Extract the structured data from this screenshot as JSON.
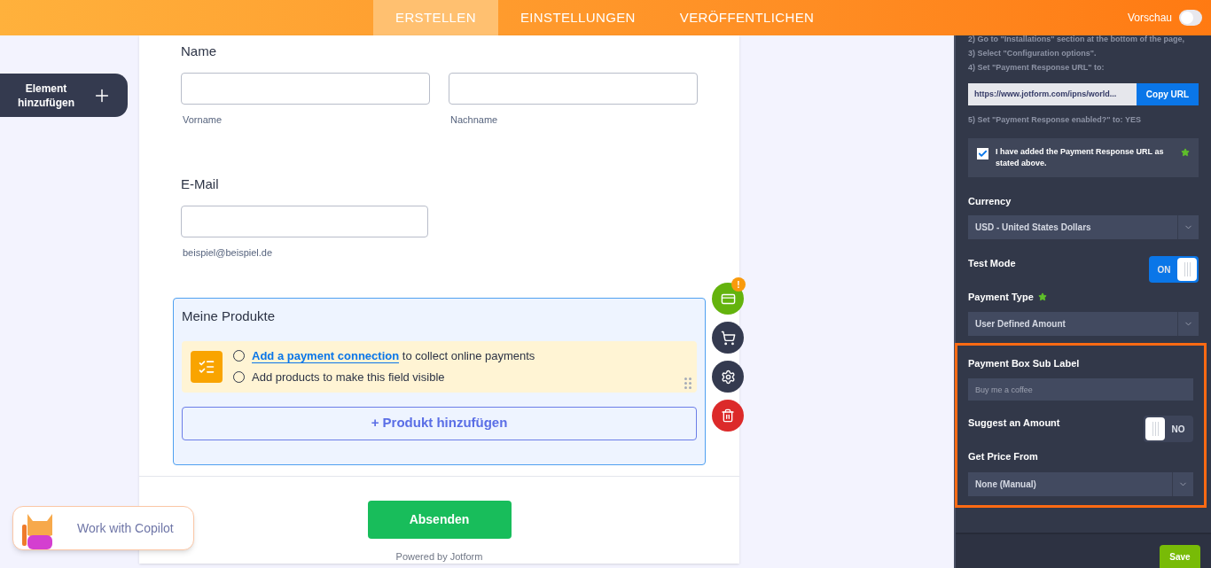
{
  "header": {
    "tabs": [
      {
        "label": "ERSTELLEN",
        "selected": true
      },
      {
        "label": "EINSTELLUNGEN",
        "selected": false
      },
      {
        "label": "VERÖFFENTLICHEN",
        "selected": false
      }
    ],
    "preview": {
      "label": "Vorschau",
      "on": false
    }
  },
  "add_element": {
    "label": "Element hinzufügen"
  },
  "form": {
    "name_field": {
      "label": "Name",
      "inputs": [
        {
          "sublabel": "Vorname"
        },
        {
          "sublabel": "Nachname"
        }
      ]
    },
    "email_field": {
      "label": "E-Mail",
      "sublabel": "beispiel@beispiel.de"
    },
    "products_field": {
      "label": "Meine Produkte",
      "notices": [
        {
          "link": "Add a payment connection",
          "text": "to collect online payments",
          "checked": false
        },
        {
          "text": "Add products to make this field visible",
          "checked": false
        }
      ],
      "add_button": "+ Produkt hinzufügen"
    },
    "submit": "Absenden",
    "powered_by": "Powered by Jotform"
  },
  "field_actions": {
    "badge": "!"
  },
  "copilot": {
    "label": "Work with Copilot"
  },
  "settings_panel": {
    "steps": [
      "2) Go to \"Installations\" section at the bottom of the page,",
      "3) Select \"Configuration options\".",
      "4) Set \"Payment Response URL\" to:"
    ],
    "url": "https://www.jotform.com/ipns/world...",
    "copy_button": "Copy URL",
    "step_5": "5) Set \"Payment Response enabled?\" to: YES",
    "confirm": {
      "label": "I have added the Payment Response URL as stated above.",
      "checked": true
    },
    "currency": {
      "label": "Currency",
      "value": "USD - United States Dollars"
    },
    "test_mode": {
      "label": "Test Mode",
      "on": true,
      "state_text": "ON"
    },
    "payment_type": {
      "label": "Payment Type",
      "value": "User Defined Amount"
    },
    "sub_label": {
      "label": "Payment Box Sub Label",
      "placeholder": "Buy me a coffee"
    },
    "suggest_amount": {
      "label": "Suggest an Amount",
      "on": false,
      "state_text": "NO"
    },
    "price_from": {
      "label": "Get Price From",
      "value": "None (Manual)"
    },
    "save": "Save"
  }
}
